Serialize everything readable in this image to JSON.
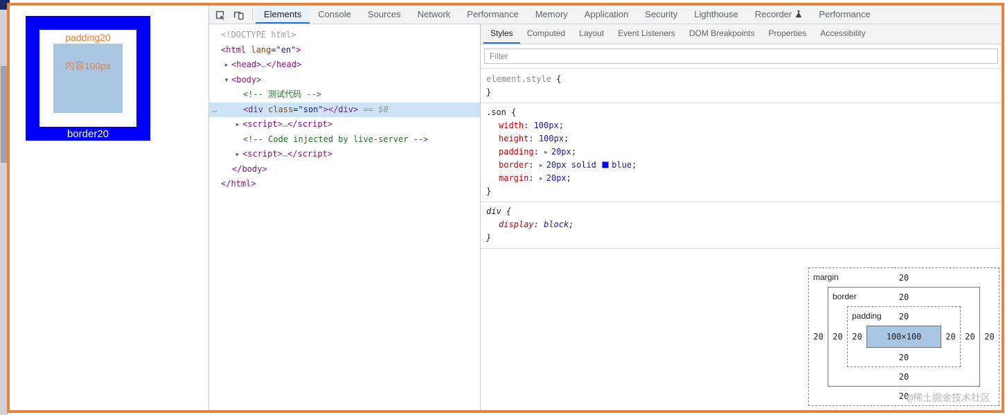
{
  "colors": {
    "accent_blue": "#1a73e8",
    "selection_blue": "#cde4f7",
    "box_blue": "#0000fc",
    "content_fill": "#a9c7e3",
    "annotation_orange": "#e8833c",
    "swatch_blue": "#0000ff"
  },
  "demo_page": {
    "padding_label": "padding20",
    "content_label": "内容100px",
    "border_label": "border20"
  },
  "devtools": {
    "toolbar_icons": [
      "inspect-element-icon",
      "device-toolbar-icon"
    ],
    "main_tabs": [
      {
        "label": "Elements",
        "selected": true
      },
      {
        "label": "Console"
      },
      {
        "label": "Sources"
      },
      {
        "label": "Network"
      },
      {
        "label": "Performance"
      },
      {
        "label": "Memory"
      },
      {
        "label": "Application"
      },
      {
        "label": "Security"
      },
      {
        "label": "Lighthouse"
      },
      {
        "label": "Recorder",
        "icon": "flask-icon"
      },
      {
        "label": "Performance"
      }
    ],
    "elements_tree": [
      {
        "indent": 0,
        "segments": [
          {
            "c": "doctype",
            "t": "<!DOCTYPE html>"
          }
        ]
      },
      {
        "indent": 0,
        "segments": [
          {
            "c": "tag",
            "t": "<html"
          },
          {
            "c": "attr",
            "t": " lang"
          },
          {
            "c": "punct",
            "t": "="
          },
          {
            "c": "val",
            "t": "\"en\""
          },
          {
            "c": "tag",
            "t": ">"
          }
        ]
      },
      {
        "indent": 1,
        "arrow": "right",
        "segments": [
          {
            "c": "tag",
            "t": "<head>"
          },
          {
            "c": "muted",
            "t": "…"
          },
          {
            "c": "tag",
            "t": "</head>"
          }
        ]
      },
      {
        "indent": 1,
        "arrow": "down",
        "segments": [
          {
            "c": "tag",
            "t": "<body>"
          }
        ]
      },
      {
        "indent": 2,
        "segments": [
          {
            "c": "comment",
            "t": "<!-- 测试代码 -->"
          }
        ]
      },
      {
        "indent": 2,
        "selected": true,
        "gutter": "…",
        "segments": [
          {
            "c": "tag",
            "t": "<div"
          },
          {
            "c": "attr",
            "t": " class"
          },
          {
            "c": "punct",
            "t": "="
          },
          {
            "c": "val",
            "t": "\"son\""
          },
          {
            "c": "tag",
            "t": "></div>"
          },
          {
            "c": "eq",
            "t": " == $0"
          }
        ]
      },
      {
        "indent": 2,
        "arrow": "right",
        "segments": [
          {
            "c": "tag",
            "t": "<script>"
          },
          {
            "c": "muted",
            "t": "…"
          },
          {
            "c": "tag",
            "t": "</script>"
          }
        ]
      },
      {
        "indent": 2,
        "segments": [
          {
            "c": "comment",
            "t": "<!-- Code injected by live-server -->"
          }
        ]
      },
      {
        "indent": 2,
        "arrow": "right",
        "segments": [
          {
            "c": "tag",
            "t": "<script>"
          },
          {
            "c": "muted",
            "t": "…"
          },
          {
            "c": "tag",
            "t": "</script>"
          }
        ]
      },
      {
        "indent": 1,
        "segments": [
          {
            "c": "tag",
            "t": "</body>"
          }
        ]
      },
      {
        "indent": 0,
        "segments": [
          {
            "c": "tag",
            "t": "</html>"
          }
        ]
      }
    ],
    "styles_pane": {
      "tabs": [
        {
          "label": "Styles",
          "selected": true
        },
        {
          "label": "Computed"
        },
        {
          "label": "Layout"
        },
        {
          "label": "Event Listeners"
        },
        {
          "label": "DOM Breakpoints"
        },
        {
          "label": "Properties"
        },
        {
          "label": "Accessibility"
        }
      ],
      "filter_placeholder": "Filter",
      "rules": [
        {
          "selector": "element.style",
          "selector_class": "muted",
          "props": []
        },
        {
          "selector": ".son",
          "props": [
            {
              "name": "width",
              "value": "100px"
            },
            {
              "name": "height",
              "value": "100px"
            },
            {
              "name": "padding",
              "value": "20px",
              "expandable": true
            },
            {
              "name": "border",
              "value_prefix": "20px solid ",
              "swatch": "#0000ff",
              "value": "blue",
              "expandable": true
            },
            {
              "name": "margin",
              "value": "20px",
              "expandable": true
            }
          ]
        },
        {
          "selector": "div",
          "italic": true,
          "props": [
            {
              "name": "display",
              "value": "block"
            }
          ]
        }
      ],
      "box_model": {
        "margin_label": "margin",
        "border_label": "border",
        "padding_label": "padding",
        "content": "100×100",
        "margin": {
          "top": "20",
          "right": "20",
          "bottom": "20",
          "left": "20"
        },
        "border": {
          "top": "20",
          "right": "20",
          "bottom": "20",
          "left": "20"
        },
        "padding": {
          "top": "20",
          "right": "20",
          "bottom": "20",
          "left": "20"
        }
      }
    },
    "watermark": "@稀土掘金技术社区"
  }
}
